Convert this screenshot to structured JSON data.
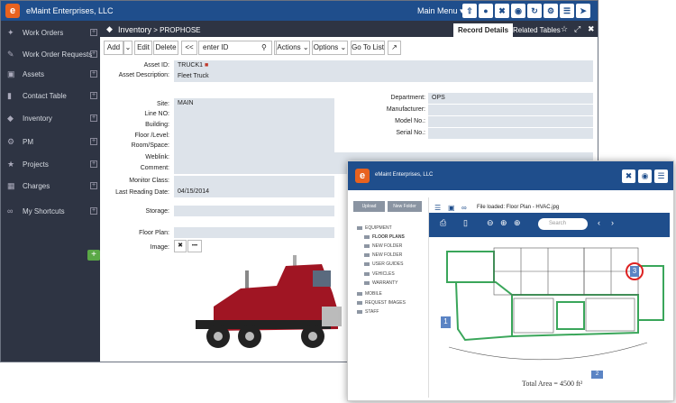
{
  "app": {
    "logo": "e",
    "company": "eMaint Enterprises, LLC",
    "main_menu": "Main Menu ▾",
    "toolbar_icons": [
      "upload-icon",
      "mic-icon",
      "tools-icon",
      "camera-icon",
      "refresh-icon",
      "gear-icon",
      "menu-icon",
      "send-icon"
    ]
  },
  "sidebar": {
    "items": [
      {
        "label": "Work Orders",
        "icon": "wrench-icon"
      },
      {
        "label": "Work Order Requests",
        "icon": "clipboard-icon"
      },
      {
        "label": "Assets",
        "icon": "box-icon"
      },
      {
        "label": "Contact Table",
        "icon": "book-icon"
      },
      {
        "label": "Inventory",
        "icon": "tag-icon"
      },
      {
        "label": "PM",
        "icon": "gears-icon"
      },
      {
        "label": "Projects",
        "icon": "trophy-icon"
      },
      {
        "label": "Charges",
        "icon": "calendar-icon"
      },
      {
        "label": "My Shortcuts",
        "icon": "link-icon"
      }
    ],
    "add": "+"
  },
  "breadcrumb": {
    "module": "Inventory",
    "sub": "> PROPHOSE"
  },
  "tabs": {
    "record": "Record Details",
    "related": "Related Tables"
  },
  "actions": {
    "add": "Add",
    "edit": "Edit",
    "delete": "Delete",
    "prev": "<<",
    "next": ">>",
    "enter_id_placeholder": "enter ID",
    "actions": "Actions",
    "options": "Options",
    "goto": "Go To List"
  },
  "record": {
    "asset_id_label": "Asset ID:",
    "asset_id": "TRUCK1",
    "desc_label": "Asset Description:",
    "desc": "Fleet Truck",
    "site_label": "Site:",
    "site": "MAIN",
    "line_label": "Line NO:",
    "building_label": "Building:",
    "floor_label": "Floor /Level:",
    "room_label": "Room/Space:",
    "weblink_label": "Weblink:",
    "comment_label": "Comment:",
    "monitor_label": "Monitor Class:",
    "last_label": "Last Reading Date:",
    "last": "04/15/2014",
    "storage_label": "Storage:",
    "floorplan_label": "Floor Plan:",
    "image_label": "Image:",
    "dept_label": "Department:",
    "dept": "OPS",
    "manu_label": "Manufacturer:",
    "model_label": "Model No.:",
    "serial_label": "Serial No.:"
  },
  "image_btns": {
    "remove": "✖",
    "more": "•••"
  },
  "panel": {
    "company": "eMaint Enterprises, LLC",
    "upload": "Upload",
    "new_folder": "New Folder",
    "file_loaded": "File loaded: Floor Plan - HVAC.jpg",
    "search_placeholder": "Search",
    "folders": [
      "EQUIPMENT",
      "FLOOR PLANS",
      "NEW FOLDER",
      "NEW FOLDER",
      "USER GUIDES",
      "VEHICLES",
      "WARRANTY",
      "MOBILE",
      "REQUEST IMAGES",
      "STAFF"
    ],
    "total_area": "Total Area = 4500 ft²",
    "markers": [
      "1",
      "2",
      "3"
    ]
  }
}
